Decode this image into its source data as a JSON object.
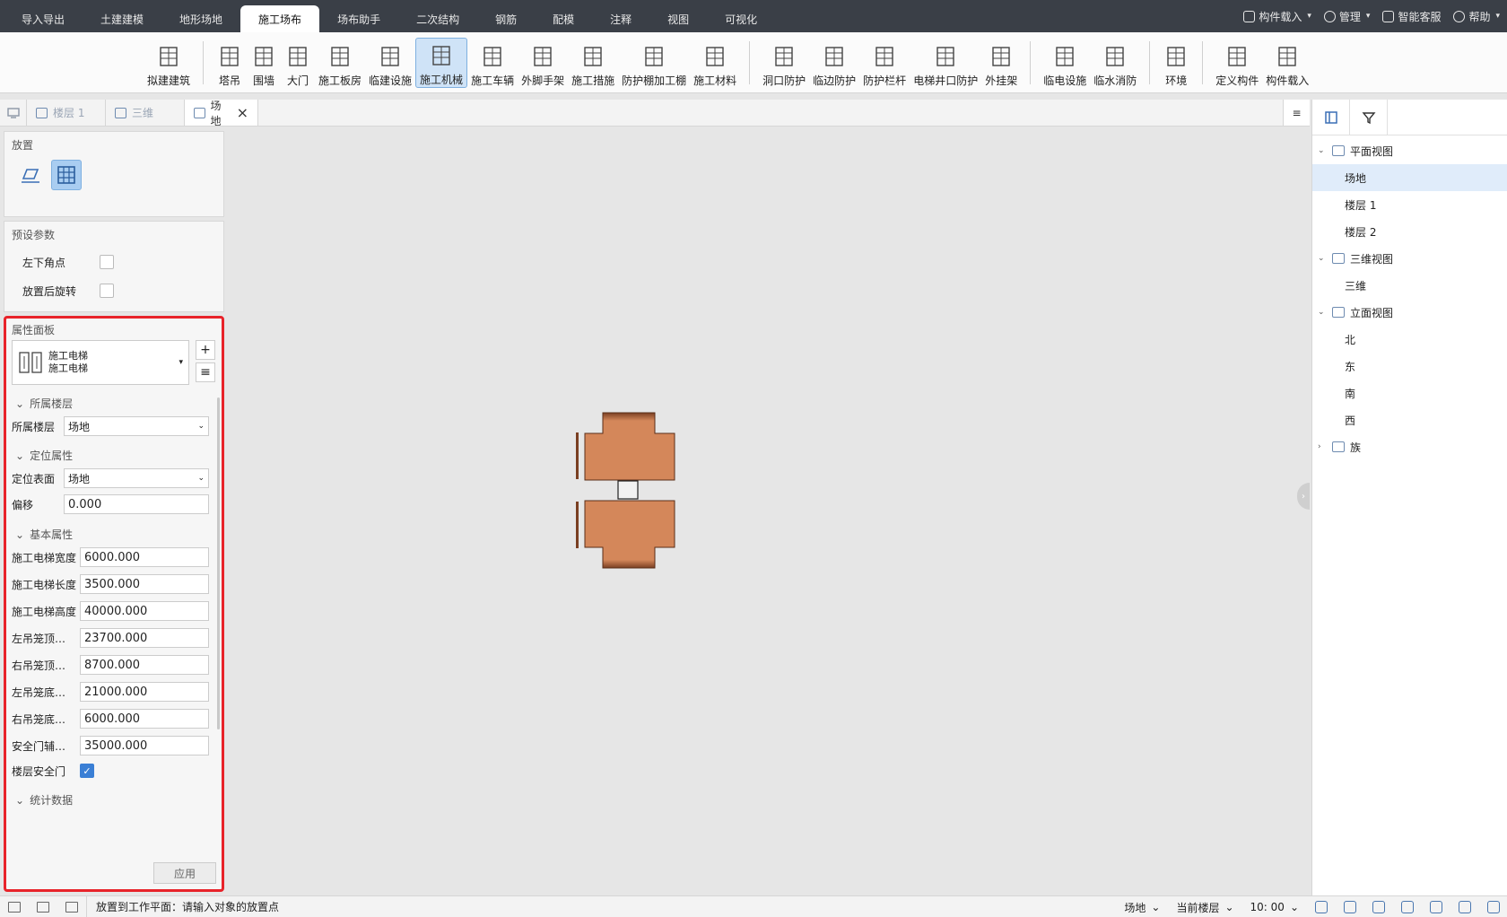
{
  "menu": {
    "tabs": [
      "导入导出",
      "土建建模",
      "地形场地",
      "施工场布",
      "场布助手",
      "二次结构",
      "钢筋",
      "配模",
      "注释",
      "视图",
      "可视化"
    ],
    "active_index": 3,
    "right": {
      "component_load": "构件载入",
      "manage": "管理",
      "smart_service": "智能客服",
      "help": "帮助"
    }
  },
  "ribbon": {
    "buttons": [
      "拟建建筑",
      "塔吊",
      "围墙",
      "大门",
      "施工板房",
      "临建设施",
      "施工机械",
      "施工车辆",
      "外脚手架",
      "施工措施",
      "防护棚加工棚",
      "施工材料",
      "洞口防护",
      "临边防护",
      "防护栏杆",
      "电梯井口防护",
      "外挂架",
      "临电设施",
      "临水消防",
      "环境",
      "定义构件",
      "构件载入"
    ],
    "active": "施工机械"
  },
  "doctabs": {
    "tabs": [
      {
        "label": "楼层 1"
      },
      {
        "label": "三维"
      },
      {
        "label": "场地"
      }
    ],
    "active": "场地"
  },
  "left": {
    "place_title": "放置",
    "preset_title": "预设参数",
    "preset": [
      {
        "label": "左下角点",
        "checked": false
      },
      {
        "label": "放置后旋转",
        "checked": false
      }
    ],
    "props_title": "属性面板",
    "type_line1": "施工电梯",
    "type_line2": "施工电梯",
    "sec_floor": "所属楼层",
    "floor_label": "所属楼层",
    "floor_value": "场地",
    "sec_position": "定位属性",
    "surface_label": "定位表面",
    "surface_value": "场地",
    "offset_label": "偏移",
    "offset_value": "0.000",
    "sec_basic": "基本属性",
    "fields": [
      {
        "label": "施工电梯宽度",
        "value": "6000.000"
      },
      {
        "label": "施工电梯长度",
        "value": "3500.000"
      },
      {
        "label": "施工电梯高度",
        "value": "40000.000"
      },
      {
        "label": "左吊笼顶…",
        "value": "23700.000"
      },
      {
        "label": "右吊笼顶…",
        "value": "8700.000"
      },
      {
        "label": "左吊笼底…",
        "value": "21000.000"
      },
      {
        "label": "右吊笼底…",
        "value": "6000.000"
      },
      {
        "label": "安全门辅…",
        "value": "35000.000"
      }
    ],
    "floor_door_label": "楼层安全门",
    "floor_door_checked": true,
    "sec_stats": "统计数据",
    "apply": "应用"
  },
  "tree": {
    "plan": "平面视图",
    "plan_items": [
      "场地",
      "楼层 1",
      "楼层 2"
    ],
    "selected": "场地",
    "threed": "三维视图",
    "threed_items": [
      "三维"
    ],
    "elev": "立面视图",
    "elev_items": [
      "北",
      "东",
      "南",
      "西"
    ],
    "family": "族"
  },
  "status": {
    "message": "放置到工作平面：请输入对象的放置点",
    "site": "场地",
    "current_floor": "当前楼层",
    "time": "10: 00"
  },
  "colors": {
    "accent": "#3a7fd5",
    "highlight_border": "#e8232a",
    "elevator_fill": "#d4875a"
  }
}
